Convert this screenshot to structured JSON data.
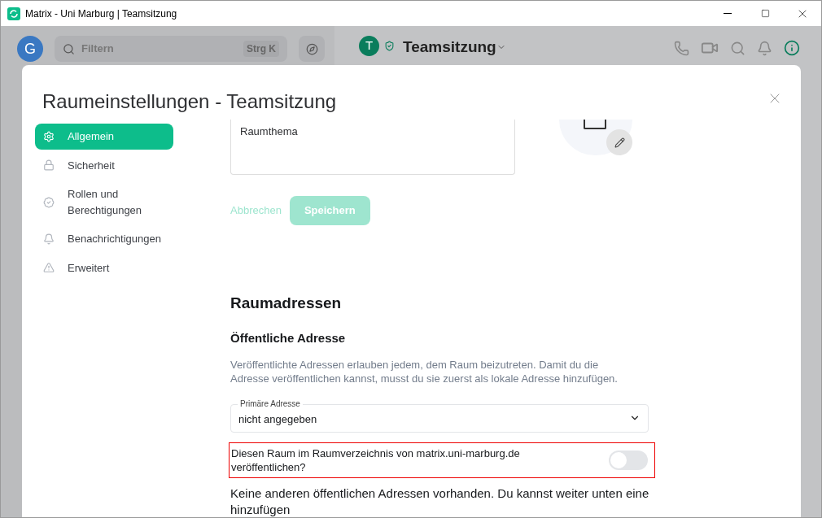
{
  "window": {
    "title": "Matrix - Uni Marburg | Teamsitzung"
  },
  "app": {
    "user_avatar": "G",
    "search": {
      "placeholder": "Filtern",
      "shortcut": "Strg K"
    },
    "room": {
      "avatar": "T",
      "name": "Teamsitzung"
    }
  },
  "dialog": {
    "title": "Raumeinstellungen - Teamsitzung",
    "tabs": [
      {
        "label": "Allgemein",
        "selected": true,
        "kind": "gear"
      },
      {
        "label": "Sicherheit",
        "selected": false,
        "kind": "lock"
      },
      {
        "label": "Rollen und Berechtigungen",
        "selected": false,
        "kind": "badge"
      },
      {
        "label": "Benachrichtigungen",
        "selected": false,
        "kind": "bell"
      },
      {
        "label": "Erweitert",
        "selected": false,
        "kind": "warning"
      }
    ],
    "topic": {
      "placeholder": "Raumthema"
    },
    "buttons": {
      "cancel": {
        "label": "Abbrechen",
        "disabled": true
      },
      "save": {
        "label": "Speichern",
        "disabled": true
      }
    },
    "addresses": {
      "heading": "Raumadressen",
      "subheading": "Öffentliche Adresse",
      "description": "Veröffentlichte Adressen erlauben jedem, dem Raum beizutreten. Damit du die Adresse veröffentlichen kannst, musst du sie zuerst als lokale Adresse hinzufügen.",
      "primary": {
        "label": "Primäre Adresse",
        "value": "nicht angegeben"
      },
      "publish": {
        "label": "Diesen Raum im Raumverzeichnis von matrix.uni-marburg.de veröffentlichen?",
        "on": false
      },
      "note": "Keine anderen öffentlichen Adressen vorhanden. Du kannst weiter unten eine hinzufügen"
    }
  }
}
